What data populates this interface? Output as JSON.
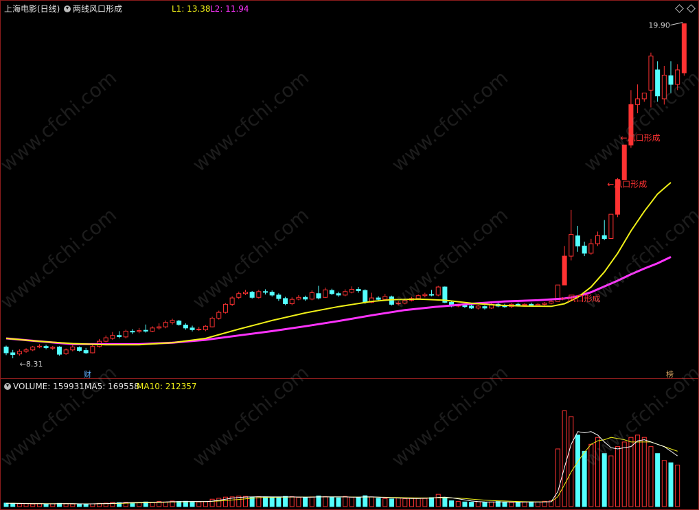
{
  "header": {
    "stock_name": "上海电影(日线)",
    "indicator_name": "两线风口形成",
    "l1_label": "L1: 13.38",
    "l2_label": "L2: 11.94"
  },
  "badges": {
    "bottom_left": "财",
    "bottom_right": "榜"
  },
  "volume_header": {
    "volume_label": "VOLUME: 159931",
    "ma5_label": "MA5: 169558",
    "ma10_label": "MA10: 212357"
  },
  "watermark": "www.cfchi.com",
  "colors": {
    "up": "#ff3232",
    "down": "#54ffff",
    "ma_yellow": "#f0f018",
    "ma_magenta": "#ff33ff",
    "vol_ma5": "#ffffff",
    "vol_ma10": "#f0f018",
    "frame": "#8a1c1c"
  },
  "chart_data": {
    "type": "candlestick",
    "price_range": [
      8.0,
      20.2
    ],
    "max_label": "19.90",
    "min_label": "8.31",
    "annotations": [
      {
        "text": "←风口形成",
        "index": 83,
        "price": 10.38
      },
      {
        "text": "←风口形成",
        "index": 90,
        "price": 14.34
      },
      {
        "text": "←风口形成",
        "index": 92,
        "price": 15.94
      }
    ],
    "candles": [
      [
        8.7,
        8.5,
        8.75,
        8.42
      ],
      [
        8.5,
        8.44,
        8.6,
        8.31
      ],
      [
        8.46,
        8.55,
        8.62,
        8.4
      ],
      [
        8.55,
        8.6,
        8.66,
        8.5
      ],
      [
        8.6,
        8.7,
        8.74,
        8.56
      ],
      [
        8.7,
        8.73,
        8.8,
        8.66
      ],
      [
        8.72,
        8.68,
        8.78,
        8.62
      ],
      [
        8.66,
        8.69,
        8.74,
        8.6
      ],
      [
        8.7,
        8.45,
        8.73,
        8.4
      ],
      [
        8.47,
        8.6,
        8.65,
        8.43
      ],
      [
        8.6,
        8.7,
        8.76,
        8.55
      ],
      [
        8.68,
        8.58,
        8.72,
        8.54
      ],
      [
        8.58,
        8.5,
        8.67,
        8.46
      ],
      [
        8.5,
        8.72,
        8.78,
        8.48
      ],
      [
        8.72,
        8.9,
        8.98,
        8.68
      ],
      [
        8.9,
        9.02,
        9.1,
        8.86
      ],
      [
        9.0,
        9.1,
        9.22,
        8.95
      ],
      [
        9.1,
        9.06,
        9.25,
        9.0
      ],
      [
        9.05,
        9.25,
        9.3,
        9.0
      ],
      [
        9.25,
        9.22,
        9.32,
        9.15
      ],
      [
        9.24,
        9.27,
        9.36,
        9.18
      ],
      [
        9.28,
        9.25,
        9.48,
        9.2
      ],
      [
        9.25,
        9.36,
        9.42,
        9.22
      ],
      [
        9.36,
        9.4,
        9.52,
        9.3
      ],
      [
        9.4,
        9.55,
        9.62,
        9.35
      ],
      [
        9.55,
        9.62,
        9.68,
        9.48
      ],
      [
        9.6,
        9.48,
        9.64,
        9.44
      ],
      [
        9.46,
        9.36,
        9.52,
        9.3
      ],
      [
        9.36,
        9.3,
        9.44,
        9.24
      ],
      [
        9.3,
        9.32,
        9.4,
        9.26
      ],
      [
        9.3,
        9.42,
        9.46,
        9.25
      ],
      [
        9.4,
        9.7,
        9.75,
        9.38
      ],
      [
        9.7,
        9.9,
        9.96,
        9.65
      ],
      [
        9.9,
        10.18,
        10.22,
        9.86
      ],
      [
        10.18,
        10.4,
        10.46,
        10.12
      ],
      [
        10.42,
        10.55,
        10.62,
        10.36
      ],
      [
        10.55,
        10.6,
        10.68,
        10.5
      ],
      [
        10.6,
        10.42,
        10.64,
        10.38
      ],
      [
        10.42,
        10.62,
        10.68,
        10.38
      ],
      [
        10.62,
        10.6,
        10.7,
        10.52
      ],
      [
        10.6,
        10.5,
        10.66,
        10.45
      ],
      [
        10.5,
        10.38,
        10.56,
        10.3
      ],
      [
        10.38,
        10.2,
        10.44,
        10.15
      ],
      [
        10.2,
        10.35,
        10.42,
        10.15
      ],
      [
        10.36,
        10.42,
        10.5,
        10.32
      ],
      [
        10.42,
        10.36,
        10.48,
        10.3
      ],
      [
        10.36,
        10.58,
        10.66,
        10.32
      ],
      [
        10.55,
        10.4,
        10.82,
        10.35
      ],
      [
        10.42,
        10.68,
        10.76,
        10.4
      ],
      [
        10.66,
        10.55,
        10.72,
        10.5
      ],
      [
        10.55,
        10.5,
        10.62,
        10.44
      ],
      [
        10.5,
        10.62,
        10.7,
        10.46
      ],
      [
        10.6,
        10.7,
        10.8,
        10.56
      ],
      [
        10.7,
        10.65,
        10.78,
        10.58
      ],
      [
        10.66,
        10.25,
        10.7,
        10.2
      ],
      [
        10.25,
        10.4,
        10.58,
        10.22
      ],
      [
        10.4,
        10.35,
        10.46,
        10.3
      ],
      [
        10.35,
        10.45,
        10.54,
        10.32
      ],
      [
        10.44,
        10.18,
        10.48,
        10.14
      ],
      [
        10.2,
        10.22,
        10.3,
        10.14
      ],
      [
        10.22,
        10.32,
        10.38,
        10.18
      ],
      [
        10.32,
        10.38,
        10.44,
        10.28
      ],
      [
        10.38,
        10.48,
        10.52,
        10.34
      ],
      [
        10.48,
        10.52,
        10.58,
        10.42
      ],
      [
        10.52,
        10.5,
        10.68,
        10.46
      ],
      [
        10.5,
        10.78,
        10.82,
        10.46
      ],
      [
        10.78,
        10.25,
        10.8,
        10.22
      ],
      [
        10.25,
        10.12,
        10.3,
        10.08
      ],
      [
        10.12,
        10.15,
        10.2,
        10.08
      ],
      [
        10.15,
        10.1,
        10.2,
        10.05
      ],
      [
        10.12,
        10.05,
        10.18,
        10.02
      ],
      [
        10.05,
        10.12,
        10.16,
        10.0
      ],
      [
        10.1,
        10.05,
        10.14,
        10.0
      ],
      [
        10.05,
        10.18,
        10.22,
        10.02
      ],
      [
        10.18,
        10.12,
        10.25,
        10.08
      ],
      [
        10.12,
        10.1,
        10.2,
        10.06
      ],
      [
        10.1,
        10.18,
        10.22,
        10.05
      ],
      [
        10.18,
        10.15,
        10.24,
        10.1
      ],
      [
        10.15,
        10.18,
        10.22,
        10.1
      ],
      [
        10.18,
        10.14,
        10.24,
        10.1
      ],
      [
        10.14,
        10.18,
        10.22,
        10.1
      ],
      [
        10.18,
        10.22,
        10.26,
        10.14
      ],
      [
        10.22,
        10.28,
        10.32,
        10.18
      ],
      [
        10.28,
        10.85,
        10.85,
        10.28
      ],
      [
        10.85,
        11.85,
        12.2,
        11.75
      ],
      [
        11.85,
        12.6,
        13.45,
        11.7
      ],
      [
        12.55,
        12.2,
        12.9,
        12.0
      ],
      [
        12.2,
        11.95,
        12.35,
        11.85
      ],
      [
        11.95,
        12.28,
        12.45,
        11.9
      ],
      [
        12.28,
        12.56,
        12.7,
        12.2
      ],
      [
        12.56,
        12.46,
        13.1,
        12.4
      ],
      [
        12.46,
        13.3,
        13.3,
        12.46
      ],
      [
        13.3,
        14.5,
        14.56,
        13.2
      ],
      [
        14.5,
        15.7,
        15.7,
        14.5
      ],
      [
        15.7,
        17.1,
        17.6,
        15.6
      ],
      [
        17.1,
        17.3,
        17.8,
        16.8
      ],
      [
        17.3,
        17.5,
        17.5,
        17.2
      ],
      [
        17.6,
        18.78,
        18.9,
        17.0
      ],
      [
        18.3,
        17.4,
        18.6,
        17.2
      ],
      [
        17.3,
        18.12,
        18.44,
        17.1
      ],
      [
        18.1,
        17.8,
        18.6,
        17.5
      ],
      [
        17.8,
        18.3,
        18.5,
        17.6
      ],
      [
        18.2,
        19.9,
        19.9,
        18.1
      ]
    ],
    "ma_yellow": [
      [
        0,
        9.0
      ],
      [
        5,
        8.9
      ],
      [
        10,
        8.82
      ],
      [
        15,
        8.78
      ],
      [
        20,
        8.78
      ],
      [
        25,
        8.85
      ],
      [
        30,
        9.0
      ],
      [
        35,
        9.32
      ],
      [
        40,
        9.62
      ],
      [
        45,
        9.88
      ],
      [
        50,
        10.1
      ],
      [
        55,
        10.28
      ],
      [
        58,
        10.34
      ],
      [
        62,
        10.36
      ],
      [
        66,
        10.32
      ],
      [
        70,
        10.22
      ],
      [
        74,
        10.15
      ],
      [
        78,
        10.12
      ],
      [
        82,
        10.11
      ],
      [
        84,
        10.2
      ],
      [
        86,
        10.42
      ],
      [
        88,
        10.78
      ],
      [
        90,
        11.3
      ],
      [
        92,
        11.95
      ],
      [
        94,
        12.72
      ],
      [
        96,
        13.4
      ],
      [
        97,
        13.7
      ],
      [
        98,
        14.0
      ],
      [
        99,
        14.2
      ],
      [
        100,
        14.4
      ]
    ],
    "ma_magenta": [
      [
        0,
        9.0
      ],
      [
        5,
        8.9
      ],
      [
        10,
        8.8
      ],
      [
        15,
        8.8
      ],
      [
        20,
        8.8
      ],
      [
        25,
        8.85
      ],
      [
        30,
        8.95
      ],
      [
        35,
        9.1
      ],
      [
        40,
        9.25
      ],
      [
        45,
        9.42
      ],
      [
        50,
        9.6
      ],
      [
        55,
        9.8
      ],
      [
        60,
        9.98
      ],
      [
        65,
        10.1
      ],
      [
        70,
        10.2
      ],
      [
        75,
        10.28
      ],
      [
        80,
        10.32
      ],
      [
        84,
        10.38
      ],
      [
        86,
        10.46
      ],
      [
        88,
        10.6
      ],
      [
        90,
        10.8
      ],
      [
        92,
        11.0
      ],
      [
        94,
        11.22
      ],
      [
        96,
        11.42
      ],
      [
        98,
        11.6
      ],
      [
        100,
        11.82
      ]
    ],
    "volume": {
      "range": [
        0,
        1000
      ],
      "up_down": "same as candles",
      "values": [
        30,
        28,
        24,
        26,
        22,
        25,
        22,
        24,
        28,
        26,
        22,
        24,
        20,
        24,
        28,
        30,
        36,
        34,
        38,
        34,
        36,
        40,
        38,
        44,
        40,
        48,
        44,
        46,
        42,
        40,
        44,
        64,
        72,
        82,
        84,
        90,
        88,
        80,
        86,
        84,
        82,
        80,
        88,
        86,
        80,
        78,
        84,
        92,
        86,
        80,
        76,
        88,
        82,
        78,
        94,
        84,
        72,
        70,
        66,
        76,
        68,
        72,
        74,
        70,
        78,
        106,
        72,
        50,
        44,
        40,
        38,
        42,
        36,
        40,
        44,
        38,
        36,
        40,
        38,
        42,
        40,
        46,
        50,
        500,
        830,
        780,
        620,
        480,
        540,
        600,
        460,
        440,
        520,
        560,
        600,
        620,
        600,
        520,
        460,
        400,
        380,
        360
      ],
      "ma5": [
        28,
        28,
        27,
        26,
        25,
        25,
        24,
        24,
        25,
        25,
        25,
        24,
        23,
        24,
        25,
        26,
        28,
        30,
        33,
        35,
        36,
        37,
        37,
        39,
        40,
        42,
        43,
        44,
        44,
        44,
        43,
        47,
        55,
        64,
        73,
        80,
        83,
        84,
        85,
        85,
        84,
        84,
        84,
        84,
        83,
        82,
        82,
        84,
        84,
        84,
        84,
        84,
        82,
        82,
        84,
        84,
        82,
        79,
        76,
        74,
        72,
        70,
        70,
        72,
        73,
        80,
        82,
        76,
        68,
        58,
        48,
        43,
        40,
        39,
        40,
        40,
        39,
        38,
        39,
        39,
        39,
        40,
        42,
        130,
        340,
        540,
        650,
        640,
        650,
        620,
        560,
        510,
        500,
        510,
        520,
        570,
        580,
        560,
        540,
        520,
        480,
        440
      ],
      "ma10": [
        28,
        28,
        28,
        27,
        26,
        26,
        25,
        25,
        25,
        25,
        25,
        24,
        24,
        24,
        25,
        25,
        26,
        27,
        29,
        31,
        32,
        33,
        34,
        36,
        37,
        39,
        40,
        41,
        42,
        43,
        43,
        45,
        48,
        52,
        57,
        62,
        67,
        72,
        77,
        79,
        80,
        81,
        82,
        83,
        83,
        83,
        83,
        84,
        84,
        84,
        84,
        84,
        83,
        83,
        83,
        83,
        82,
        81,
        79,
        78,
        77,
        76,
        75,
        75,
        75,
        76,
        76,
        75,
        73,
        70,
        65,
        60,
        56,
        52,
        50,
        48,
        46,
        44,
        42,
        41,
        41,
        41,
        42,
        86,
        190,
        300,
        390,
        470,
        540,
        570,
        580,
        600,
        590,
        580,
        560,
        560,
        560,
        560,
        540,
        520,
        500,
        480
      ]
    }
  }
}
